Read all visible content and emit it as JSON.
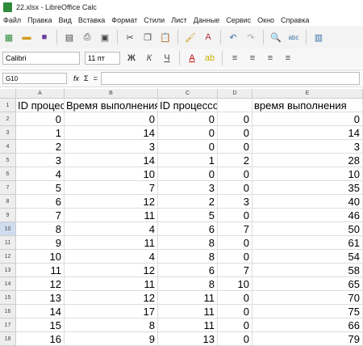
{
  "window": {
    "title": "22.xlsx - LibreOffice Calc"
  },
  "menu": [
    "Файл",
    "Правка",
    "Вид",
    "Вставка",
    "Формат",
    "Стили",
    "Лист",
    "Данные",
    "Сервис",
    "Окно",
    "Справка"
  ],
  "toolbar": {
    "font_name": "Calibri",
    "font_size": "11 пт"
  },
  "formula_bar": {
    "cell_ref": "G10",
    "fx": "fx",
    "sum": "Σ",
    "eq": "="
  },
  "sheet": {
    "columns": [
      "A",
      "B",
      "C",
      "D",
      "E"
    ],
    "header_row": {
      "A": "ID процессов",
      "B": "Время выполнения",
      "C": "ID процессов A",
      "D": "",
      "E": "время выполнения"
    },
    "rows": [
      {
        "n": "2",
        "A": "0",
        "B": "0",
        "C": "0",
        "D": "0",
        "E": "0"
      },
      {
        "n": "3",
        "A": "1",
        "B": "14",
        "C": "0",
        "D": "0",
        "E": "14"
      },
      {
        "n": "4",
        "A": "2",
        "B": "3",
        "C": "0",
        "D": "0",
        "E": "3"
      },
      {
        "n": "5",
        "A": "3",
        "B": "14",
        "C": "1",
        "D": "2",
        "E": "28"
      },
      {
        "n": "6",
        "A": "4",
        "B": "10",
        "C": "0",
        "D": "0",
        "E": "10"
      },
      {
        "n": "7",
        "A": "5",
        "B": "7",
        "C": "3",
        "D": "0",
        "E": "35"
      },
      {
        "n": "8",
        "A": "6",
        "B": "12",
        "C": "2",
        "D": "3",
        "E": "40"
      },
      {
        "n": "9",
        "A": "7",
        "B": "11",
        "C": "5",
        "D": "0",
        "E": "46"
      },
      {
        "n": "10",
        "A": "8",
        "B": "4",
        "C": "6",
        "D": "7",
        "E": "50"
      },
      {
        "n": "11",
        "A": "9",
        "B": "11",
        "C": "8",
        "D": "0",
        "E": "61"
      },
      {
        "n": "12",
        "A": "10",
        "B": "4",
        "C": "8",
        "D": "0",
        "E": "54"
      },
      {
        "n": "13",
        "A": "11",
        "B": "12",
        "C": "6",
        "D": "7",
        "E": "58"
      },
      {
        "n": "14",
        "A": "12",
        "B": "11",
        "C": "8",
        "D": "10",
        "E": "65"
      },
      {
        "n": "15",
        "A": "13",
        "B": "12",
        "C": "11",
        "D": "0",
        "E": "70"
      },
      {
        "n": "16",
        "A": "14",
        "B": "17",
        "C": "11",
        "D": "0",
        "E": "75"
      },
      {
        "n": "17",
        "A": "15",
        "B": "8",
        "C": "11",
        "D": "0",
        "E": "66"
      },
      {
        "n": "18",
        "A": "16",
        "B": "9",
        "C": "13",
        "D": "0",
        "E": "79"
      }
    ]
  }
}
